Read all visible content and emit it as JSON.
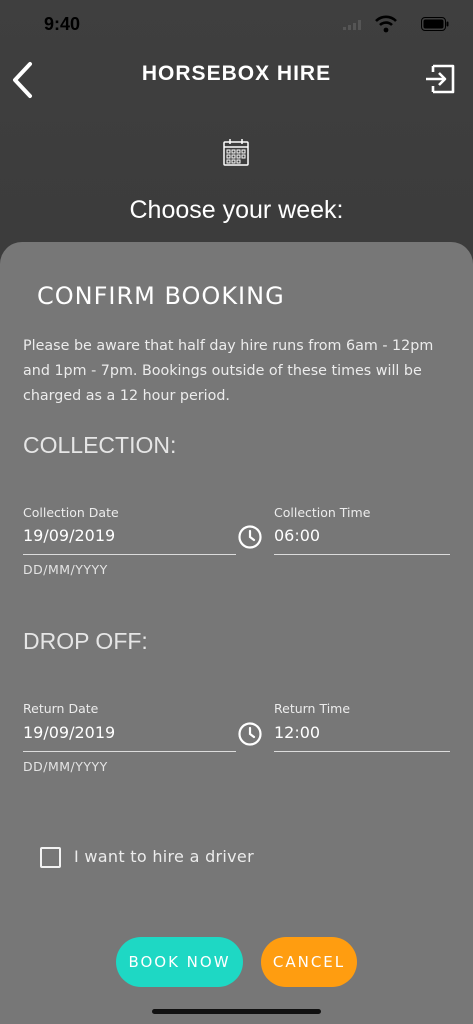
{
  "status_bar": {
    "time": "9:40"
  },
  "header": {
    "title": "HORSEBOX HIRE",
    "back_icon": "chevron-left-icon",
    "logout_icon": "logout-icon"
  },
  "page": {
    "week_label": "Choose your week:"
  },
  "modal": {
    "title": "CONFIRM BOOKING",
    "notice": "Please be aware that half day hire runs from 6am - 12pm and 1pm - 7pm. Bookings outside of these times will be charged as a 12 hour period.",
    "collection": {
      "heading": "COLLECTION:",
      "date_label": "Collection Date",
      "date_value": "19/09/2019",
      "date_hint": "DD/MM/YYYY",
      "time_label": "Collection Time",
      "time_value": "06:00"
    },
    "dropoff": {
      "heading": "DROP OFF:",
      "date_label": "Return Date",
      "date_value": "19/09/2019",
      "date_hint": "DD/MM/YYYY",
      "time_label": "Return Time",
      "time_value": "12:00"
    },
    "driver_checkbox": {
      "label": "I want to hire a driver",
      "checked": false
    },
    "buttons": {
      "book": "BOOK NOW",
      "cancel": "CANCEL"
    }
  },
  "colors": {
    "book_button": "#1ed8c4",
    "cancel_button": "#ff9d10",
    "modal_background": "#777777",
    "header_background": "#3e3e3e"
  }
}
